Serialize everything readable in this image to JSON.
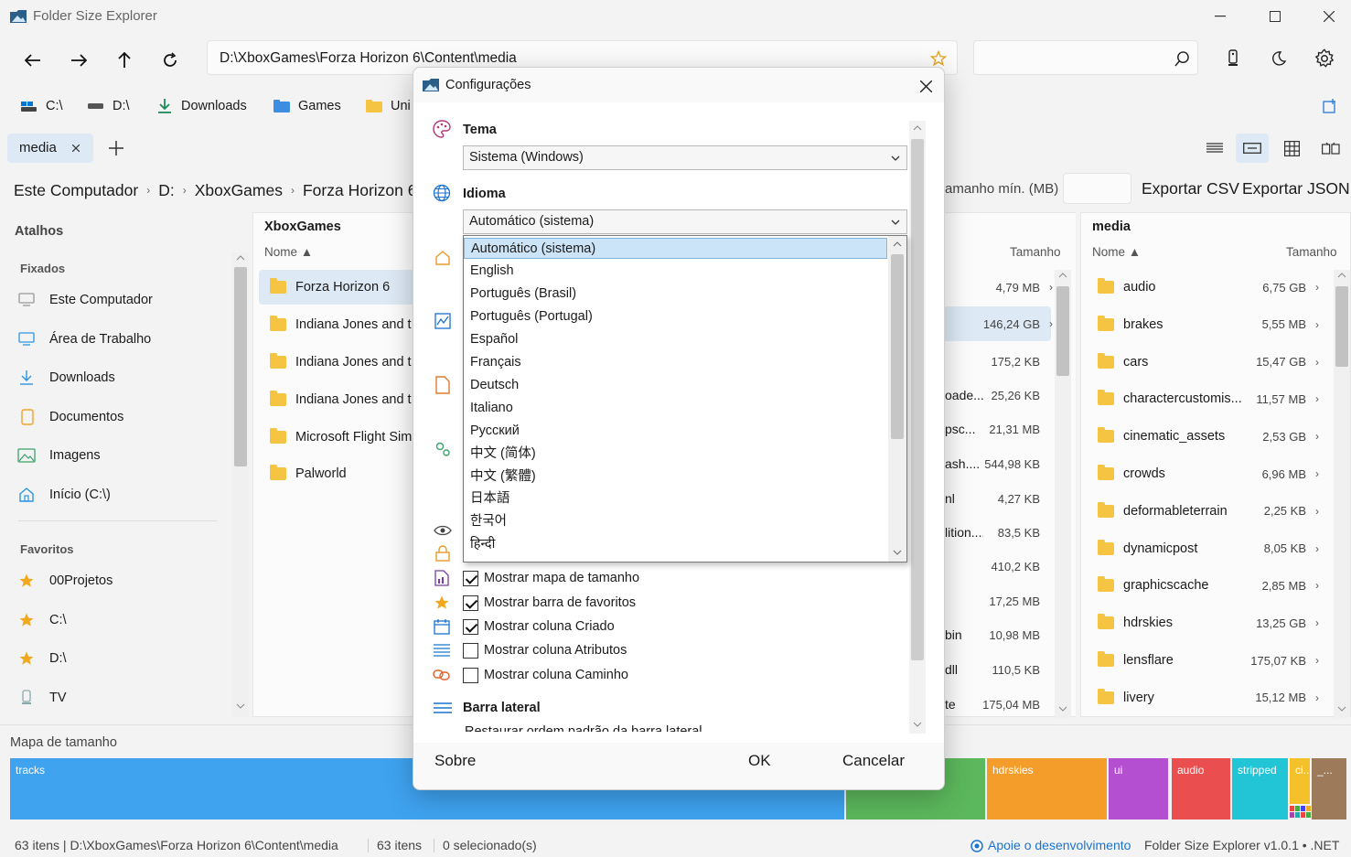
{
  "window": {
    "title": "Folder Size Explorer"
  },
  "address": {
    "path": "D:\\XboxGames\\Forza Horizon 6\\Content\\media"
  },
  "quick_bar": [
    {
      "label": "C:\\",
      "icon": "drive-c-icon"
    },
    {
      "label": "D:\\",
      "icon": "drive-d-icon"
    },
    {
      "label": "Downloads",
      "icon": "download-icon"
    },
    {
      "label": "Games",
      "icon": "folder-icon"
    },
    {
      "label": "Uni",
      "icon": "folder-icon"
    }
  ],
  "tabs": [
    {
      "label": "media"
    }
  ],
  "breadcrumb": [
    "Este Computador",
    "D:",
    "XboxGames",
    "Forza Horizon 6"
  ],
  "toolbar": {
    "min_size_label": "amanho mín. (MB)",
    "export_csv": "Exportar CSV",
    "export_json": "Exportar JSON"
  },
  "sidebar": {
    "title": "Atalhos",
    "pinned_header": "Fixados",
    "pinned": [
      {
        "label": "Este Computador",
        "icon": "computer-icon"
      },
      {
        "label": "Área de Trabalho",
        "icon": "desktop-icon"
      },
      {
        "label": "Downloads",
        "icon": "download-icon"
      },
      {
        "label": "Documentos",
        "icon": "document-icon"
      },
      {
        "label": "Imagens",
        "icon": "image-icon"
      },
      {
        "label": "Início (C:\\)",
        "icon": "home-icon"
      }
    ],
    "favorites_header": "Favoritos",
    "favorites": [
      {
        "label": "00Projetos"
      },
      {
        "label": "C:\\"
      },
      {
        "label": "D:\\"
      },
      {
        "label": "TV"
      }
    ]
  },
  "col1": {
    "title": "XboxGames",
    "header_name": "Nome ▲",
    "items": [
      "Forza Horizon 6",
      "Indiana Jones and t",
      "Indiana Jones and t",
      "Indiana Jones and t",
      "Microsoft Flight Sim",
      "Palworld"
    ]
  },
  "col2": {
    "header_size": "Tamanho",
    "items": [
      {
        "name": "",
        "size": "4,79 MB"
      },
      {
        "name": "",
        "size": "146,24 GB"
      },
      {
        "name": "",
        "size": "175,2 KB"
      },
      {
        "name": "oade...",
        "size": "25,26 KB"
      },
      {
        "name": "psc...",
        "size": "21,31 MB"
      },
      {
        "name": "ash....",
        "size": "544,98 KB"
      },
      {
        "name": "nl",
        "size": "4,27 KB"
      },
      {
        "name": "lition....",
        "size": "83,5 KB"
      },
      {
        "name": "",
        "size": "410,2 KB"
      },
      {
        "name": "",
        "size": "17,25 MB"
      },
      {
        "name": "bin",
        "size": "10,98 MB"
      },
      {
        "name": "dll",
        "size": "110,5 KB"
      },
      {
        "name": "te",
        "size": "175,04 MB"
      }
    ]
  },
  "col3": {
    "title": "media",
    "header_name": "Nome ▲",
    "header_size": "Tamanho",
    "items": [
      {
        "name": "audio",
        "size": "6,75 GB"
      },
      {
        "name": "brakes",
        "size": "5,55 MB"
      },
      {
        "name": "cars",
        "size": "15,47 GB"
      },
      {
        "name": "charactercustomis...",
        "size": "11,57 MB"
      },
      {
        "name": "cinematic_assets",
        "size": "2,53 GB"
      },
      {
        "name": "crowds",
        "size": "6,96 MB"
      },
      {
        "name": "deformableterrain",
        "size": "2,25 KB"
      },
      {
        "name": "dynamicpost",
        "size": "8,05 KB"
      },
      {
        "name": "graphicscache",
        "size": "2,85 MB"
      },
      {
        "name": "hdrskies",
        "size": "13,25 GB"
      },
      {
        "name": "lensflare",
        "size": "175,07 KB"
      },
      {
        "name": "livery",
        "size": "15,12 MB"
      }
    ]
  },
  "sizemap": {
    "title": "Mapa de tamanho",
    "tiles": [
      {
        "label": "tracks",
        "color": "#3fa3f0"
      },
      {
        "label": "",
        "color": "#5cb85c"
      },
      {
        "label": "hdrskies",
        "color": "#f59d2a"
      },
      {
        "label": "ui",
        "color": "#b44fd1"
      },
      {
        "label": "audio",
        "color": "#ea4e4e"
      },
      {
        "label": "stripped",
        "color": "#22c5d6"
      },
      {
        "label": "ci...",
        "color": "#f5c12a"
      },
      {
        "label": "_...",
        "color": "#9c7a5a"
      }
    ]
  },
  "status": {
    "left": "63 itens | D:\\XboxGames\\Forza Horizon 6\\Content\\media",
    "count": "63 itens",
    "selected": "0 selecionado(s)",
    "support": "Apoie o desenvolvimento",
    "version": "Folder Size Explorer v1.0.1 • .NET"
  },
  "dialog": {
    "title": "Configurações",
    "theme_label": "Tema",
    "theme_value": "Sistema (Windows)",
    "language_label": "Idioma",
    "language_value": "Automático (sistema)",
    "language_options": [
      "Automático (sistema)",
      "English",
      "Português (Brasil)",
      "Português (Portugal)",
      "Español",
      "Français",
      "Deutsch",
      "Italiano",
      "Русский",
      "中文 (简体)",
      "中文 (繁體)",
      "日本語",
      "한국어",
      "हिन्दी"
    ],
    "checkboxes": [
      {
        "label": "Mostrar mapa de tamanho",
        "checked": true
      },
      {
        "label": "Mostrar barra de favoritos",
        "checked": true
      },
      {
        "label": "Mostrar coluna Criado",
        "checked": true
      },
      {
        "label": "Mostrar coluna Atributos",
        "checked": false
      },
      {
        "label": "Mostrar coluna Caminho",
        "checked": false
      }
    ],
    "sidebar_section": "Barra lateral",
    "sidebar_restore": "Restaurar ordem padrão da barra lateral",
    "about": "Sobre",
    "ok": "OK",
    "cancel": "Cancelar"
  }
}
